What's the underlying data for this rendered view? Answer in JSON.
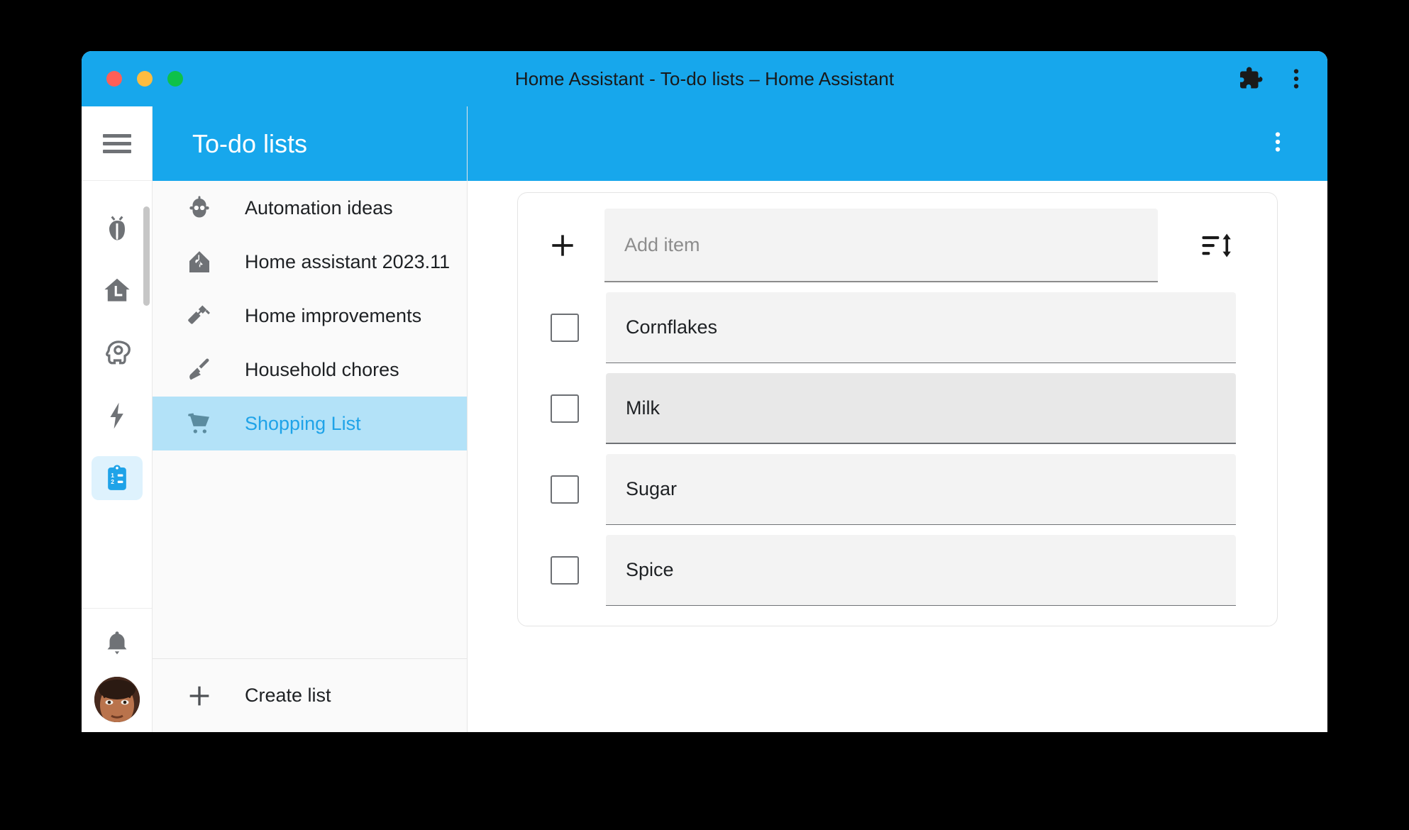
{
  "window": {
    "title": "Home Assistant - To-do lists – Home Assistant",
    "traffic_lights": [
      "close",
      "minimize",
      "maximize"
    ],
    "browser_icons": [
      "extension-puzzle-icon",
      "more-vertical-icon"
    ],
    "accent_color": "#17a7ec",
    "selected_color": "#b3e2f8",
    "link_color": "#1fa3e8"
  },
  "rail": {
    "menu_icon": "hamburger-menu-icon",
    "items": [
      {
        "name": "developer-tools",
        "icon": "ladybug-icon",
        "active": false
      },
      {
        "name": "logbook",
        "icon": "home-assistant-upload-icon",
        "active": false
      },
      {
        "name": "assist",
        "icon": "head-cog-icon",
        "active": false
      },
      {
        "name": "energy",
        "icon": "lightning-bolt-icon",
        "active": false
      },
      {
        "name": "todo-lists",
        "icon": "clipboard-list-icon",
        "active": true
      }
    ],
    "bottom_items": [
      {
        "name": "notifications",
        "icon": "bell-icon"
      },
      {
        "name": "user-profile",
        "icon": "avatar"
      }
    ],
    "scrollbar_visible": true
  },
  "lists_panel": {
    "header_title": "To-do lists",
    "items": [
      {
        "label": "Automation ideas",
        "icon": "robot-icon",
        "selected": false
      },
      {
        "label": "Home assistant 2023.11",
        "icon": "home-assistant-icon",
        "selected": false
      },
      {
        "label": "Home improvements",
        "icon": "hammer-icon",
        "selected": false
      },
      {
        "label": "Household chores",
        "icon": "broom-icon",
        "selected": false
      },
      {
        "label": "Shopping List",
        "icon": "shopping-cart-icon",
        "selected": true
      }
    ],
    "create_list": {
      "label": "Create list",
      "icon": "plus-icon"
    }
  },
  "main": {
    "overflow_icon": "more-vertical-icon",
    "add_item": {
      "placeholder": "Add item",
      "value": "",
      "add_icon": "plus-icon",
      "sort_icon": "sort-reorder-icon"
    },
    "items": [
      {
        "label": "Cornflakes",
        "checked": false,
        "hovered": false
      },
      {
        "label": "Milk",
        "checked": false,
        "hovered": true
      },
      {
        "label": "Sugar",
        "checked": false,
        "hovered": false
      },
      {
        "label": "Spice",
        "checked": false,
        "hovered": false
      }
    ]
  }
}
